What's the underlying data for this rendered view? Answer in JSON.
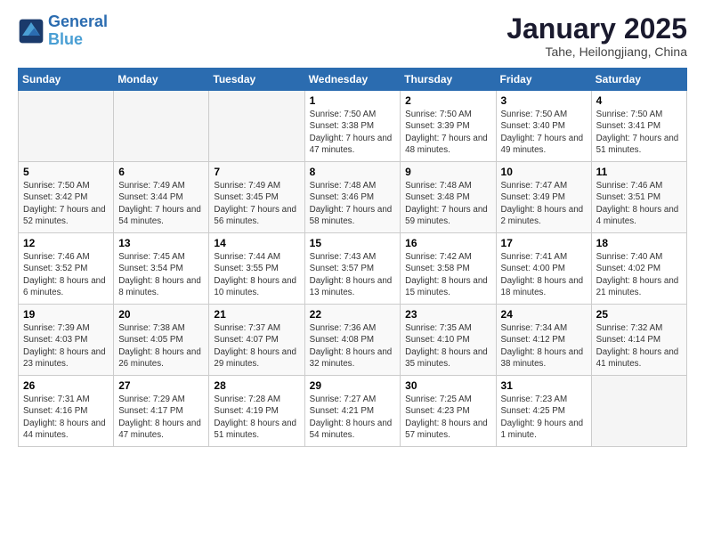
{
  "header": {
    "logo_line1": "General",
    "logo_line2": "Blue",
    "month_title": "January 2025",
    "subtitle": "Tahe, Heilongjiang, China"
  },
  "days_of_week": [
    "Sunday",
    "Monday",
    "Tuesday",
    "Wednesday",
    "Thursday",
    "Friday",
    "Saturday"
  ],
  "weeks": [
    [
      {
        "day": "",
        "empty": true
      },
      {
        "day": "",
        "empty": true
      },
      {
        "day": "",
        "empty": true
      },
      {
        "day": "1",
        "sunrise": "7:50 AM",
        "sunset": "3:38 PM",
        "daylight": "7 hours and 47 minutes."
      },
      {
        "day": "2",
        "sunrise": "7:50 AM",
        "sunset": "3:39 PM",
        "daylight": "7 hours and 48 minutes."
      },
      {
        "day": "3",
        "sunrise": "7:50 AM",
        "sunset": "3:40 PM",
        "daylight": "7 hours and 49 minutes."
      },
      {
        "day": "4",
        "sunrise": "7:50 AM",
        "sunset": "3:41 PM",
        "daylight": "7 hours and 51 minutes."
      }
    ],
    [
      {
        "day": "5",
        "sunrise": "7:50 AM",
        "sunset": "3:42 PM",
        "daylight": "7 hours and 52 minutes."
      },
      {
        "day": "6",
        "sunrise": "7:49 AM",
        "sunset": "3:44 PM",
        "daylight": "7 hours and 54 minutes."
      },
      {
        "day": "7",
        "sunrise": "7:49 AM",
        "sunset": "3:45 PM",
        "daylight": "7 hours and 56 minutes."
      },
      {
        "day": "8",
        "sunrise": "7:48 AM",
        "sunset": "3:46 PM",
        "daylight": "7 hours and 58 minutes."
      },
      {
        "day": "9",
        "sunrise": "7:48 AM",
        "sunset": "3:48 PM",
        "daylight": "7 hours and 59 minutes."
      },
      {
        "day": "10",
        "sunrise": "7:47 AM",
        "sunset": "3:49 PM",
        "daylight": "8 hours and 2 minutes."
      },
      {
        "day": "11",
        "sunrise": "7:46 AM",
        "sunset": "3:51 PM",
        "daylight": "8 hours and 4 minutes."
      }
    ],
    [
      {
        "day": "12",
        "sunrise": "7:46 AM",
        "sunset": "3:52 PM",
        "daylight": "8 hours and 6 minutes."
      },
      {
        "day": "13",
        "sunrise": "7:45 AM",
        "sunset": "3:54 PM",
        "daylight": "8 hours and 8 minutes."
      },
      {
        "day": "14",
        "sunrise": "7:44 AM",
        "sunset": "3:55 PM",
        "daylight": "8 hours and 10 minutes."
      },
      {
        "day": "15",
        "sunrise": "7:43 AM",
        "sunset": "3:57 PM",
        "daylight": "8 hours and 13 minutes."
      },
      {
        "day": "16",
        "sunrise": "7:42 AM",
        "sunset": "3:58 PM",
        "daylight": "8 hours and 15 minutes."
      },
      {
        "day": "17",
        "sunrise": "7:41 AM",
        "sunset": "4:00 PM",
        "daylight": "8 hours and 18 minutes."
      },
      {
        "day": "18",
        "sunrise": "7:40 AM",
        "sunset": "4:02 PM",
        "daylight": "8 hours and 21 minutes."
      }
    ],
    [
      {
        "day": "19",
        "sunrise": "7:39 AM",
        "sunset": "4:03 PM",
        "daylight": "8 hours and 23 minutes."
      },
      {
        "day": "20",
        "sunrise": "7:38 AM",
        "sunset": "4:05 PM",
        "daylight": "8 hours and 26 minutes."
      },
      {
        "day": "21",
        "sunrise": "7:37 AM",
        "sunset": "4:07 PM",
        "daylight": "8 hours and 29 minutes."
      },
      {
        "day": "22",
        "sunrise": "7:36 AM",
        "sunset": "4:08 PM",
        "daylight": "8 hours and 32 minutes."
      },
      {
        "day": "23",
        "sunrise": "7:35 AM",
        "sunset": "4:10 PM",
        "daylight": "8 hours and 35 minutes."
      },
      {
        "day": "24",
        "sunrise": "7:34 AM",
        "sunset": "4:12 PM",
        "daylight": "8 hours and 38 minutes."
      },
      {
        "day": "25",
        "sunrise": "7:32 AM",
        "sunset": "4:14 PM",
        "daylight": "8 hours and 41 minutes."
      }
    ],
    [
      {
        "day": "26",
        "sunrise": "7:31 AM",
        "sunset": "4:16 PM",
        "daylight": "8 hours and 44 minutes."
      },
      {
        "day": "27",
        "sunrise": "7:29 AM",
        "sunset": "4:17 PM",
        "daylight": "8 hours and 47 minutes."
      },
      {
        "day": "28",
        "sunrise": "7:28 AM",
        "sunset": "4:19 PM",
        "daylight": "8 hours and 51 minutes."
      },
      {
        "day": "29",
        "sunrise": "7:27 AM",
        "sunset": "4:21 PM",
        "daylight": "8 hours and 54 minutes."
      },
      {
        "day": "30",
        "sunrise": "7:25 AM",
        "sunset": "4:23 PM",
        "daylight": "8 hours and 57 minutes."
      },
      {
        "day": "31",
        "sunrise": "7:23 AM",
        "sunset": "4:25 PM",
        "daylight": "9 hours and 1 minute."
      },
      {
        "day": "",
        "empty": true
      }
    ]
  ]
}
